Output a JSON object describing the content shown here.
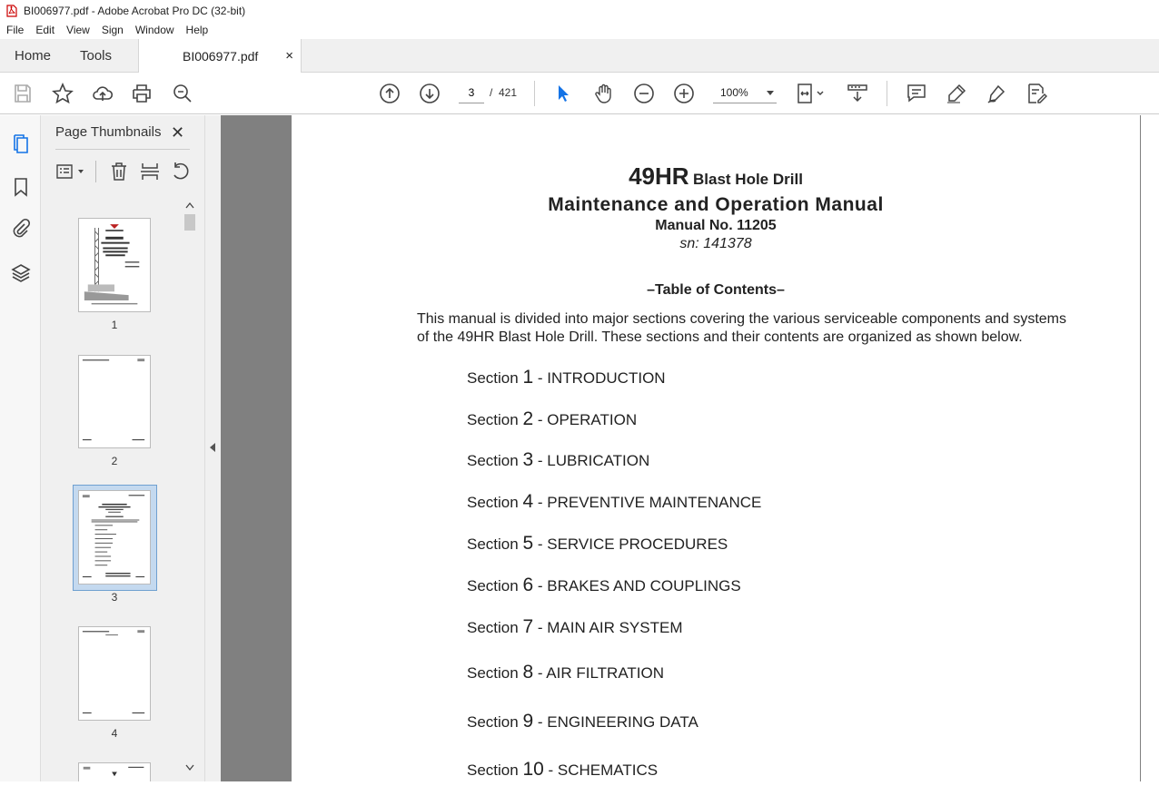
{
  "window": {
    "title": "BI006977.pdf - Adobe Acrobat Pro DC (32-bit)"
  },
  "menu": [
    "File",
    "Edit",
    "View",
    "Sign",
    "Window",
    "Help"
  ],
  "tabs": {
    "home": "Home",
    "tools": "Tools",
    "doc": "BI006977.pdf",
    "close": "×"
  },
  "nav": {
    "current_page": "3",
    "separator": "/",
    "total_pages": "421",
    "zoom": "100%"
  },
  "thumbs_panel": {
    "title": "Page Thumbnails",
    "close": "✕",
    "pages": [
      "1",
      "2",
      "3",
      "4"
    ],
    "selected": "3"
  },
  "document": {
    "model": "49HR",
    "model_suffix": "Blast Hole Drill",
    "manual_title": "Maintenance and Operation Manual",
    "manual_no": "Manual No. 11205",
    "sn": "sn: 141378",
    "toc_heading": "–Table of Contents–",
    "intro_line1": "This manual is divided into major sections covering the various serviceable components and systems",
    "intro_line2": "of the 49HR Blast Hole Drill. These sections and their contents are organized as shown below.",
    "section_word": "Section",
    "sections": [
      {
        "num": "1",
        "title": "- INTRODUCTION"
      },
      {
        "num": "2",
        "title": "- OPERATION"
      },
      {
        "num": "3",
        "title": "- LUBRICATION"
      },
      {
        "num": "4",
        "title": "- PREVENTIVE MAINTENANCE"
      },
      {
        "num": "5",
        "title": "- SERVICE PROCEDURES"
      },
      {
        "num": "6",
        "title": "- BRAKES AND COUPLINGS"
      },
      {
        "num": "7",
        "title": "- MAIN AIR SYSTEM"
      },
      {
        "num": "8",
        "title": " - AIR FILTRATION"
      },
      {
        "num": "9",
        "title": "- ENGINEERING DATA"
      },
      {
        "num": "10",
        "title": " - SCHEMATICS"
      }
    ]
  },
  "colors": {
    "accent": "#1473e6",
    "selected_thumb_bg": "#c4d9ef",
    "doc_bg": "#808080"
  }
}
